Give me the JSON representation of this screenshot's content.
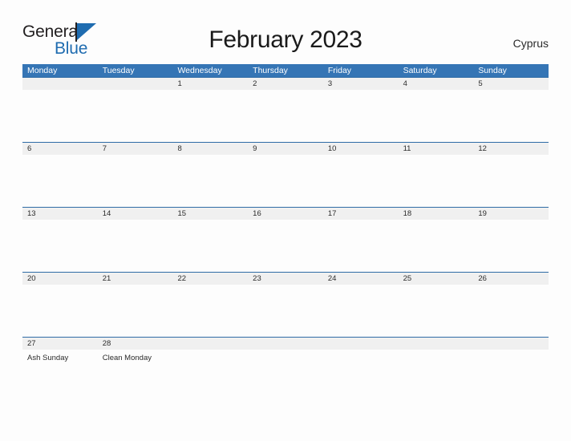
{
  "brand": {
    "name_top": "General",
    "name_bottom": "Blue",
    "flag_icon": "blue-triangle-flag-icon",
    "color_primary": "#1f6cb0",
    "color_text": "#221f20"
  },
  "header": {
    "title": "February 2023",
    "country": "Cyprus"
  },
  "theme": {
    "header_bar": "#3575b5",
    "row_divider": "#2f6ca6",
    "date_band": "#f0f0f0",
    "page_background": "#fdfdfd"
  },
  "calendar": {
    "month": "February",
    "year": "2023",
    "weekday_headers": [
      "Monday",
      "Tuesday",
      "Wednesday",
      "Thursday",
      "Friday",
      "Saturday",
      "Sunday"
    ],
    "weeks": [
      {
        "days": [
          {
            "date": "",
            "event": ""
          },
          {
            "date": "",
            "event": ""
          },
          {
            "date": "1",
            "event": ""
          },
          {
            "date": "2",
            "event": ""
          },
          {
            "date": "3",
            "event": ""
          },
          {
            "date": "4",
            "event": ""
          },
          {
            "date": "5",
            "event": ""
          }
        ]
      },
      {
        "days": [
          {
            "date": "6",
            "event": ""
          },
          {
            "date": "7",
            "event": ""
          },
          {
            "date": "8",
            "event": ""
          },
          {
            "date": "9",
            "event": ""
          },
          {
            "date": "10",
            "event": ""
          },
          {
            "date": "11",
            "event": ""
          },
          {
            "date": "12",
            "event": ""
          }
        ]
      },
      {
        "days": [
          {
            "date": "13",
            "event": ""
          },
          {
            "date": "14",
            "event": ""
          },
          {
            "date": "15",
            "event": ""
          },
          {
            "date": "16",
            "event": ""
          },
          {
            "date": "17",
            "event": ""
          },
          {
            "date": "18",
            "event": ""
          },
          {
            "date": "19",
            "event": ""
          }
        ]
      },
      {
        "days": [
          {
            "date": "20",
            "event": ""
          },
          {
            "date": "21",
            "event": ""
          },
          {
            "date": "22",
            "event": ""
          },
          {
            "date": "23",
            "event": ""
          },
          {
            "date": "24",
            "event": ""
          },
          {
            "date": "25",
            "event": ""
          },
          {
            "date": "26",
            "event": ""
          }
        ]
      },
      {
        "days": [
          {
            "date": "27",
            "event": "Ash Sunday"
          },
          {
            "date": "28",
            "event": "Clean Monday"
          },
          {
            "date": "",
            "event": ""
          },
          {
            "date": "",
            "event": ""
          },
          {
            "date": "",
            "event": ""
          },
          {
            "date": "",
            "event": ""
          },
          {
            "date": "",
            "event": ""
          }
        ]
      }
    ]
  }
}
